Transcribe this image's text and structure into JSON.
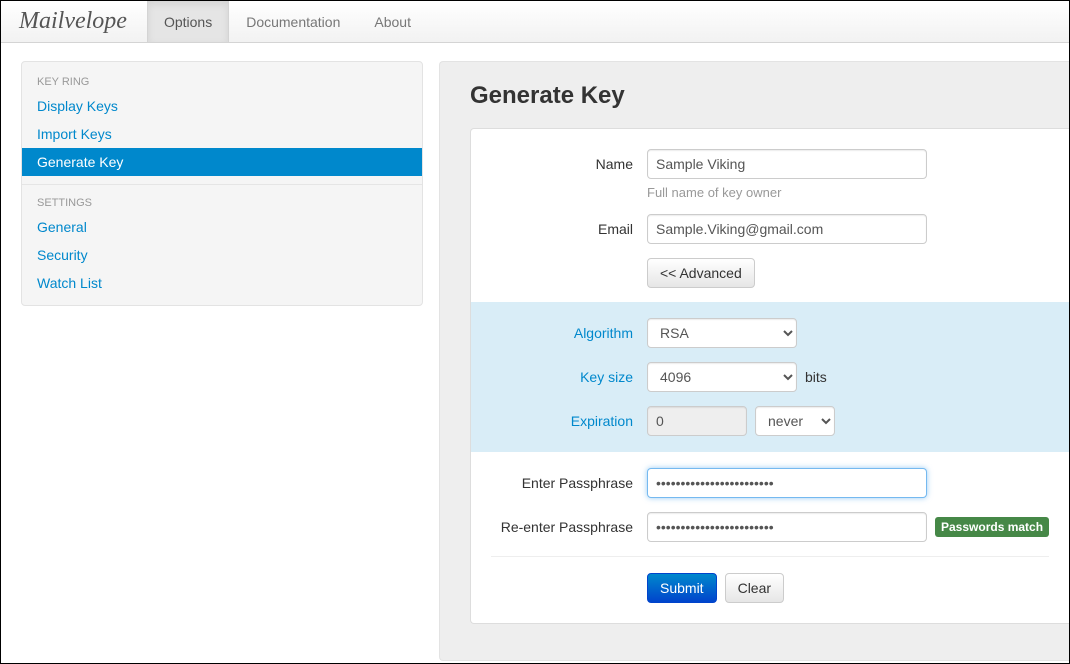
{
  "brand": "Mailvelope",
  "nav": {
    "options": "Options",
    "documentation": "Documentation",
    "about": "About"
  },
  "sidebar": {
    "keyring_header": "KEY RING",
    "display_keys": "Display Keys",
    "import_keys": "Import Keys",
    "generate_key": "Generate Key",
    "settings_header": "SETTINGS",
    "general": "General",
    "security": "Security",
    "watch_list": "Watch List"
  },
  "page": {
    "title": "Generate Key"
  },
  "form": {
    "name_label": "Name",
    "name_value": "Sample Viking",
    "name_help": "Full name of key owner",
    "email_label": "Email",
    "email_value": "Sample.Viking@gmail.com",
    "advanced_btn": "<< Advanced",
    "algorithm_label": "Algorithm",
    "algorithm_value": "RSA",
    "keysize_label": "Key size",
    "keysize_value": "4096",
    "keysize_unit": "bits",
    "expiration_label": "Expiration",
    "expiration_value": "0",
    "expiration_unit": "never",
    "pass1_label": "Enter Passphrase",
    "pass1_value": "••••••••••••••••••••••••",
    "pass2_label": "Re-enter Passphrase",
    "pass2_value": "••••••••••••••••••••••••",
    "match_badge": "Passwords match",
    "submit": "Submit",
    "clear": "Clear"
  }
}
